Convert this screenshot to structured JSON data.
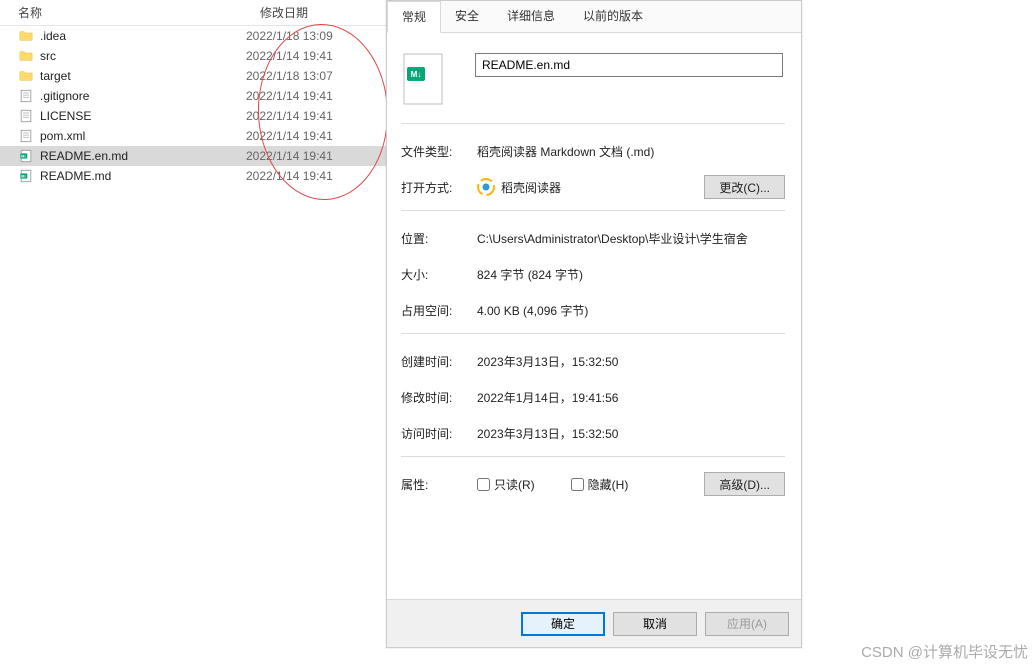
{
  "file_pane": {
    "header": {
      "name": "名称",
      "date": "修改日期"
    },
    "rows": [
      {
        "type": "folder",
        "name": ".idea",
        "date": "2022/1/18 13:09",
        "selected": false
      },
      {
        "type": "folder",
        "name": "src",
        "date": "2022/1/14 19:41",
        "selected": false
      },
      {
        "type": "folder",
        "name": "target",
        "date": "2022/1/18 13:07",
        "selected": false
      },
      {
        "type": "file",
        "name": ".gitignore",
        "date": "2022/1/14 19:41",
        "selected": false,
        "icon": "text"
      },
      {
        "type": "file",
        "name": "LICENSE",
        "date": "2022/1/14 19:41",
        "selected": false,
        "icon": "text"
      },
      {
        "type": "file",
        "name": "pom.xml",
        "date": "2022/1/14 19:41",
        "selected": false,
        "icon": "text"
      },
      {
        "type": "file",
        "name": "README.en.md",
        "date": "2022/1/14 19:41",
        "selected": true,
        "icon": "md"
      },
      {
        "type": "file",
        "name": "README.md",
        "date": "2022/1/14 19:41",
        "selected": false,
        "icon": "md"
      }
    ]
  },
  "dialog": {
    "tabs": {
      "general": "常规",
      "security": "安全",
      "details": "详细信息",
      "previous": "以前的版本"
    },
    "filename": "README.en.md",
    "labels": {
      "filetype": "文件类型:",
      "openwith": "打开方式:",
      "location": "位置:",
      "size": "大小:",
      "sizeOnDisk": "占用空间:",
      "created": "创建时间:",
      "modified": "修改时间:",
      "accessed": "访问时间:",
      "attributes": "属性:"
    },
    "values": {
      "filetype": "稻壳阅读器 Markdown 文档 (.md)",
      "openwith_app": "稻壳阅读器",
      "location": "C:\\Users\\Administrator\\Desktop\\毕业设计\\学生宿舍",
      "size": "824 字节 (824 字节)",
      "sizeOnDisk": "4.00 KB (4,096 字节)",
      "created": "2023年3月13日，15:32:50",
      "modified": "2022年1月14日，19:41:56",
      "accessed": "2023年3月13日，15:32:50"
    },
    "buttons": {
      "change": "更改(C)...",
      "advanced": "高级(D)...",
      "ok": "确定",
      "cancel": "取消",
      "apply": "应用(A)"
    },
    "checkboxes": {
      "readonly": "只读(R)",
      "hidden": "隐藏(H)"
    }
  },
  "watermark": "CSDN @计算机毕设无忧"
}
